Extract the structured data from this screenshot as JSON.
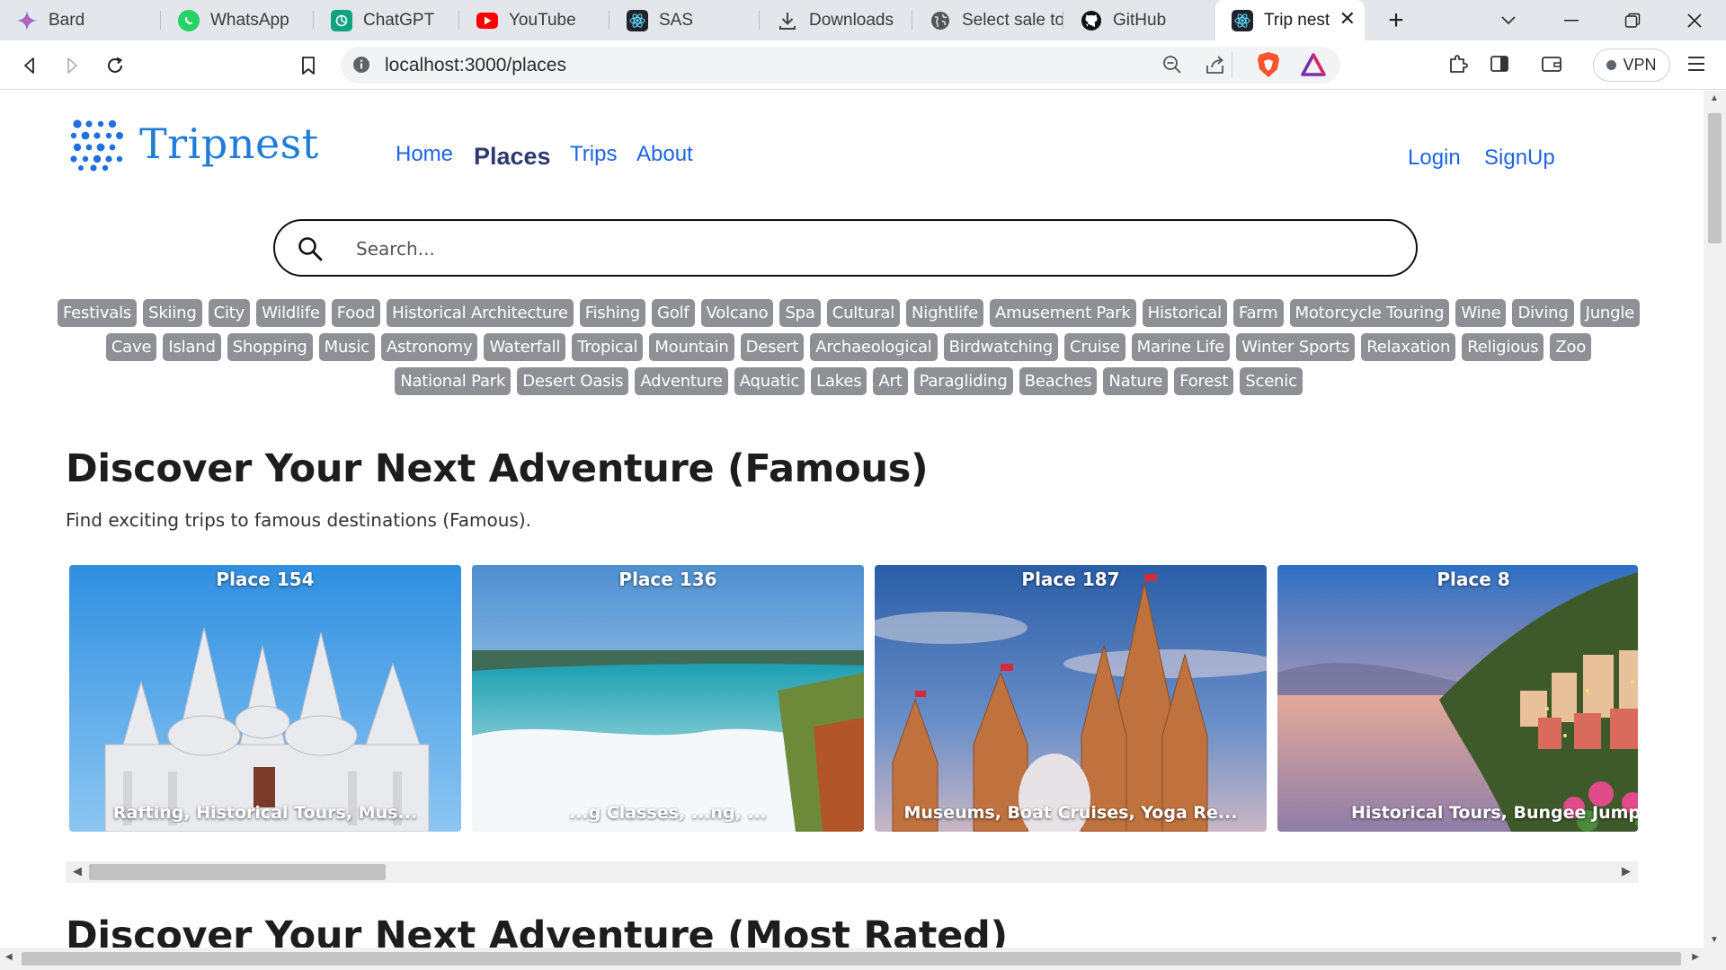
{
  "browser": {
    "tabs": [
      {
        "title": "Bard",
        "icon": "bard-icon"
      },
      {
        "title": "WhatsApp",
        "icon": "whatsapp-icon"
      },
      {
        "title": "ChatGPT",
        "icon": "chatgpt-icon"
      },
      {
        "title": "YouTube",
        "icon": "youtube-icon"
      },
      {
        "title": "SAS",
        "icon": "react-icon"
      },
      {
        "title": "Downloads",
        "icon": "download-icon"
      },
      {
        "title": "Select sale to",
        "icon": "globe-icon"
      },
      {
        "title": "GitHub",
        "icon": "github-icon"
      },
      {
        "title": "Trip nest",
        "icon": "react-icon",
        "active": true
      }
    ],
    "url": "localhost:3000/places",
    "vpn_label": "VPN"
  },
  "site": {
    "brand": "Tripnest",
    "nav": {
      "home": "Home",
      "places": "Places",
      "trips": "Trips",
      "about": "About",
      "login": "Login",
      "signup": "SignUp"
    },
    "search": {
      "placeholder": "Search...",
      "value": ""
    },
    "tag_rows": [
      [
        "Festivals",
        "Skiing",
        "City",
        "Wildlife",
        "Food",
        "Historical Architecture",
        "Fishing",
        "Golf",
        "Volcano",
        "Spa",
        "Cultural",
        "Nightlife",
        "Amusement Park",
        "Historical",
        "Farm",
        "Motorcycle Touring",
        "Wine",
        "Diving",
        "Jungle"
      ],
      [
        "Cave",
        "Island",
        "Shopping",
        "Music",
        "Astronomy",
        "Waterfall",
        "Tropical",
        "Mountain",
        "Desert",
        "Archaeological",
        "Birdwatching",
        "Cruise",
        "Marine Life",
        "Winter Sports",
        "Relaxation",
        "Religious",
        "Zoo"
      ],
      [
        "National Park",
        "Desert Oasis",
        "Adventure",
        "Aquatic",
        "Lakes",
        "Art",
        "Paragliding",
        "Beaches",
        "Nature",
        "Forest",
        "Scenic"
      ]
    ],
    "famous": {
      "title": "Discover Your Next Adventure (Famous)",
      "subtitle": "Find exciting trips to famous destinations (Famous).",
      "cards": [
        {
          "title": "Place 154",
          "activities": "Rafting, Historical Tours, Mus..."
        },
        {
          "title": "Place 136",
          "activities": "...g Classes, ...ng, ..."
        },
        {
          "title": "Place 187",
          "activities": "Museums, Boat Cruises, Yoga Re..."
        },
        {
          "title": "Place 8",
          "activities": "Historical Tours, Bungee Jumpi..."
        }
      ]
    },
    "most_rated": {
      "title": "Discover Your Next Adventure (Most Rated)"
    }
  },
  "colors": {
    "brand_blue": "#1f7dd8",
    "nav_blue": "#1e64e6",
    "nav_active": "#2c3a72",
    "tag_bg": "#8e9095"
  }
}
